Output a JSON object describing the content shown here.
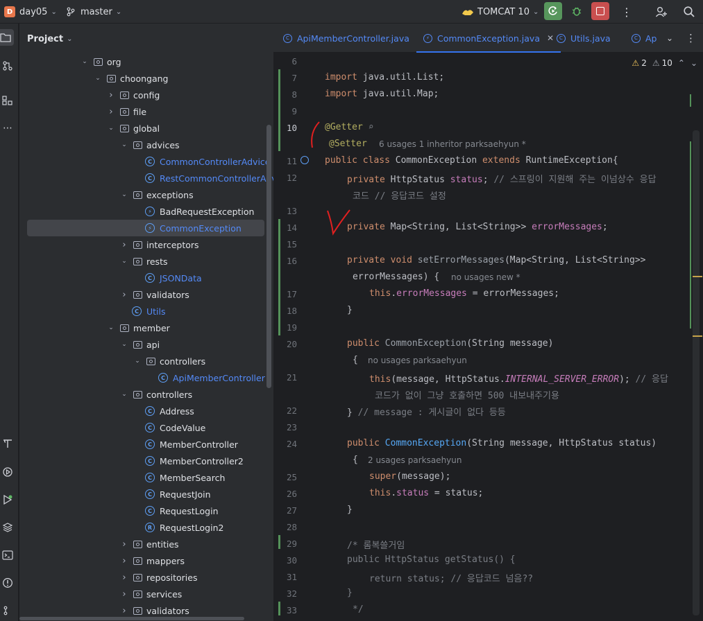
{
  "topbar": {
    "project_badge": "D",
    "project_name": "day05",
    "branch": "master",
    "run_config": "TOMCAT 10",
    "more": "⋮"
  },
  "project_panel": {
    "title": "Project",
    "tree": [
      {
        "label": "org",
        "kind": "folder",
        "depth": 0,
        "expanded": true
      },
      {
        "label": "choongang",
        "kind": "folder",
        "depth": 1,
        "expanded": true
      },
      {
        "label": "config",
        "kind": "folder",
        "depth": 2,
        "expanded": false
      },
      {
        "label": "file",
        "kind": "folder",
        "depth": 2,
        "expanded": false
      },
      {
        "label": "global",
        "kind": "folder",
        "depth": 2,
        "expanded": true
      },
      {
        "label": "advices",
        "kind": "folder",
        "depth": 3,
        "expanded": true
      },
      {
        "label": "CommonControllerAdvice",
        "kind": "class",
        "depth": 4,
        "blue": true
      },
      {
        "label": "RestCommonControllerAdvice",
        "kind": "class",
        "depth": 4,
        "blue": true
      },
      {
        "label": "exceptions",
        "kind": "folder",
        "depth": 3,
        "expanded": true
      },
      {
        "label": "BadRequestException",
        "kind": "exception",
        "depth": 4
      },
      {
        "label": "CommonException",
        "kind": "exception",
        "depth": 4,
        "blue": true,
        "selected": true
      },
      {
        "label": "interceptors",
        "kind": "folder",
        "depth": 3,
        "expanded": false
      },
      {
        "label": "rests",
        "kind": "folder",
        "depth": 3,
        "expanded": true
      },
      {
        "label": "JSONData",
        "kind": "class",
        "depth": 4,
        "blue": true
      },
      {
        "label": "validators",
        "kind": "folder",
        "depth": 3,
        "expanded": false
      },
      {
        "label": "Utils",
        "kind": "class",
        "depth": 3,
        "blue": true
      },
      {
        "label": "member",
        "kind": "folder",
        "depth": 2,
        "expanded": true
      },
      {
        "label": "api",
        "kind": "folder",
        "depth": 3,
        "expanded": true
      },
      {
        "label": "controllers",
        "kind": "folder",
        "depth": 4,
        "expanded": true
      },
      {
        "label": "ApiMemberController",
        "kind": "class",
        "depth": 5,
        "blue": true
      },
      {
        "label": "controllers",
        "kind": "folder",
        "depth": 3,
        "expanded": true
      },
      {
        "label": "Address",
        "kind": "class",
        "depth": 4
      },
      {
        "label": "CodeValue",
        "kind": "class",
        "depth": 4
      },
      {
        "label": "MemberController",
        "kind": "class",
        "depth": 4
      },
      {
        "label": "MemberController2",
        "kind": "class",
        "depth": 4
      },
      {
        "label": "MemberSearch",
        "kind": "class",
        "depth": 4
      },
      {
        "label": "RequestJoin",
        "kind": "class",
        "depth": 4
      },
      {
        "label": "RequestLogin",
        "kind": "class",
        "depth": 4
      },
      {
        "label": "RequestLogin2",
        "kind": "record",
        "depth": 4
      },
      {
        "label": "entities",
        "kind": "folder",
        "depth": 3,
        "expanded": false
      },
      {
        "label": "mappers",
        "kind": "folder",
        "depth": 3,
        "expanded": false
      },
      {
        "label": "repositories",
        "kind": "folder",
        "depth": 3,
        "expanded": false
      },
      {
        "label": "services",
        "kind": "folder",
        "depth": 3,
        "expanded": false
      },
      {
        "label": "validators",
        "kind": "folder",
        "depth": 3,
        "expanded": false
      }
    ]
  },
  "tabs": [
    {
      "label": "ApiMemberController.java",
      "active": false
    },
    {
      "label": "CommonException.java",
      "active": true
    },
    {
      "label": "Utils.java",
      "active": false
    },
    {
      "label": "Ap",
      "active": false
    }
  ],
  "editor": {
    "warnings": "2",
    "weak_warnings": "10",
    "hints": {
      "setter": "6 usages   1 inheritor   parksaehyun *",
      "setErrorMessages": "no usages   new *",
      "ctor1": "no usages   parksaehyun",
      "ctor2": "2 usages   parksaehyun"
    },
    "line_numbers": [
      "6",
      "7",
      "8",
      "9",
      "10",
      "",
      "11",
      "12",
      "",
      "13",
      "14",
      "15",
      "16",
      "",
      "17",
      "18",
      "19",
      "20",
      "",
      "21",
      "",
      "22",
      "23",
      "24",
      "",
      "25",
      "26",
      "27",
      "28",
      "29",
      "30",
      "31",
      "32",
      "33"
    ]
  },
  "colors": {
    "accent": "#3574f0",
    "class_blue": "#548af7",
    "keyword": "#cf8e6d",
    "field": "#c77dbb",
    "annotation": "#b3ae60",
    "vcs_changed": "#549159"
  }
}
